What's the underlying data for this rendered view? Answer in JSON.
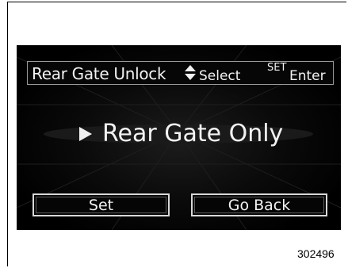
{
  "header": {
    "title": "Rear Gate Unlock",
    "select_label": "Select",
    "set_label": "SET",
    "enter_label": "Enter"
  },
  "option": {
    "label": "Rear Gate Only"
  },
  "buttons": {
    "set_label": "Set",
    "back_label": "Go Back"
  },
  "figure_id": "302496",
  "icons": {
    "select": "up-down-arrows-icon",
    "pointer": "triangle-right-icon"
  },
  "colors": {
    "screen_bg": "#000000",
    "text": "#f2f2f2",
    "button_border": "#d8d8d8"
  }
}
